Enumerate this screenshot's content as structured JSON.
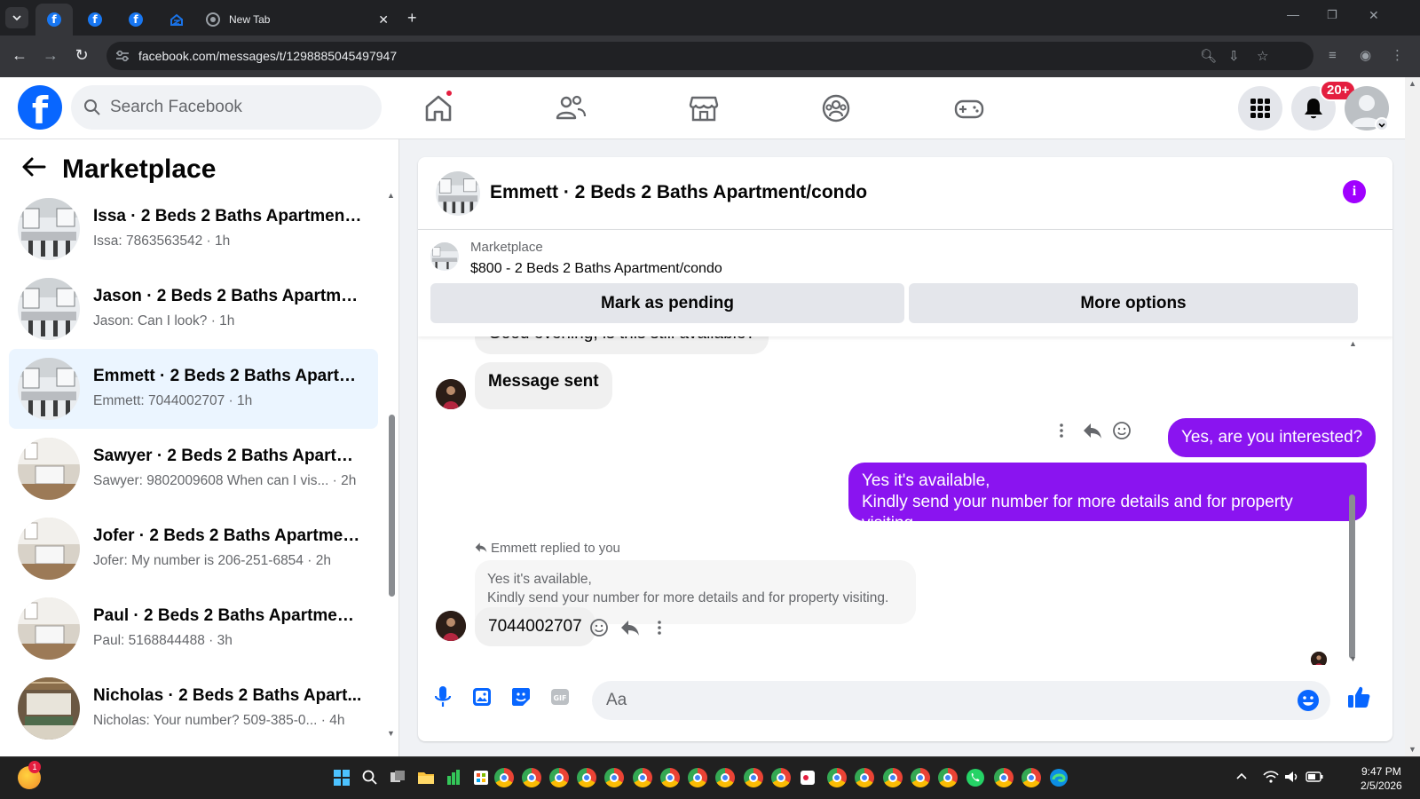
{
  "browser": {
    "tabs": [
      {
        "label": "",
        "icon": "facebook-favicon"
      },
      {
        "label": "",
        "icon": "facebook-favicon"
      },
      {
        "label": "",
        "icon": "facebook-favicon"
      },
      {
        "label": "",
        "icon": "zillow-favicon"
      },
      {
        "label": "New Tab",
        "icon": "chrome-favicon"
      }
    ],
    "url": "facebook.com/messages/t/1298885045497947"
  },
  "fb": {
    "search_placeholder": "Search Facebook",
    "notification_count": "20+"
  },
  "sidebar": {
    "title": "Marketplace",
    "conversations": [
      {
        "title": "Issa · 2 Beds 2 Baths Apartment/...",
        "subtitle": "Issa: 7863563542 · 1h"
      },
      {
        "title": "Jason · 2 Beds 2 Baths Apartmen...",
        "subtitle": "Jason: Can I look? · 1h"
      },
      {
        "title": "Emmett · 2 Beds 2 Baths Apartm...",
        "subtitle": "Emmett: 7044002707 · 1h"
      },
      {
        "title": "Sawyer · 2 Beds 2 Baths Apartme...",
        "subtitle": "Sawyer: 9802009608 When can I vis... · 2h"
      },
      {
        "title": "Jofer · 2 Beds 2 Baths Apartment...",
        "subtitle": "Jofer: My number is 206-251-6854 · 2h"
      },
      {
        "title": "Paul · 2 Beds 2 Baths Apartment/...",
        "subtitle": "Paul: 5168844488 · 3h"
      },
      {
        "title": "Nicholas · 2 Beds 2 Baths Apart...",
        "subtitle": "Nicholas: Your number? 509-385-0... · 4h"
      }
    ]
  },
  "chat": {
    "title": "Emmett · 2 Beds 2 Baths Apartment/condo",
    "listing_source": "Marketplace",
    "listing_title": "$800 - 2 Beds 2 Baths Apartment/condo",
    "mark_pending_label": "Mark as pending",
    "more_options_label": "More options",
    "messages": {
      "in_1": "Good evening, is this still available?",
      "in_2": "Message sent",
      "out_1": "Yes, are you interested?",
      "out_2_line1": "Yes it's available,",
      "out_2_line2": "Kindly send your number for more details and for property visiting.",
      "reply_label": "Emmett replied to you",
      "quoted_line1": "Yes it's available,",
      "quoted_line2": "Kindly send your number for more details and for property visiting.",
      "in_3": "7044002707"
    },
    "composer_placeholder": "Aa"
  },
  "taskbar": {
    "time": "9:47 PM",
    "date": "2/5/2026"
  },
  "colors": {
    "facebook_blue": "#0866ff",
    "message_out": "#8a14f0",
    "info_purple": "#a000ff",
    "selected_row": "#ebf5ff",
    "badge_red": "#e41e3f"
  }
}
